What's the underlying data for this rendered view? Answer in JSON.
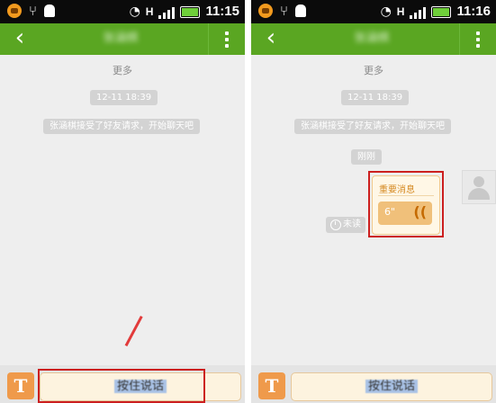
{
  "screens": [
    {
      "status": {
        "time": "11:15"
      },
      "title": "张涵棋",
      "more": "更多",
      "timestamp": "12-11 18:39",
      "system_msg": "张涵棋接受了好友请求，开始聊天吧",
      "input": {
        "hold_label": "按住说话"
      }
    },
    {
      "status": {
        "time": "11:16"
      },
      "title": "张涵棋",
      "more": "更多",
      "timestamp": "12-11 18:39",
      "system_msg": "张涵棋接受了好友请求，开始聊天吧",
      "just_now": "刚刚",
      "message": {
        "title": "重要消息",
        "duration": "6\"",
        "status": "未读"
      },
      "input": {
        "hold_label": "按住说话"
      }
    }
  ],
  "icons": {
    "back": "back-arrow-icon",
    "menu": "overflow-menu-icon",
    "keyboard": "text-input-icon",
    "voice": "voice-wave-icon",
    "clock": "clock-icon"
  },
  "colors": {
    "appbar": "#5aa622",
    "highlight": "#cc1f1f",
    "accent": "#ef9a4b"
  }
}
